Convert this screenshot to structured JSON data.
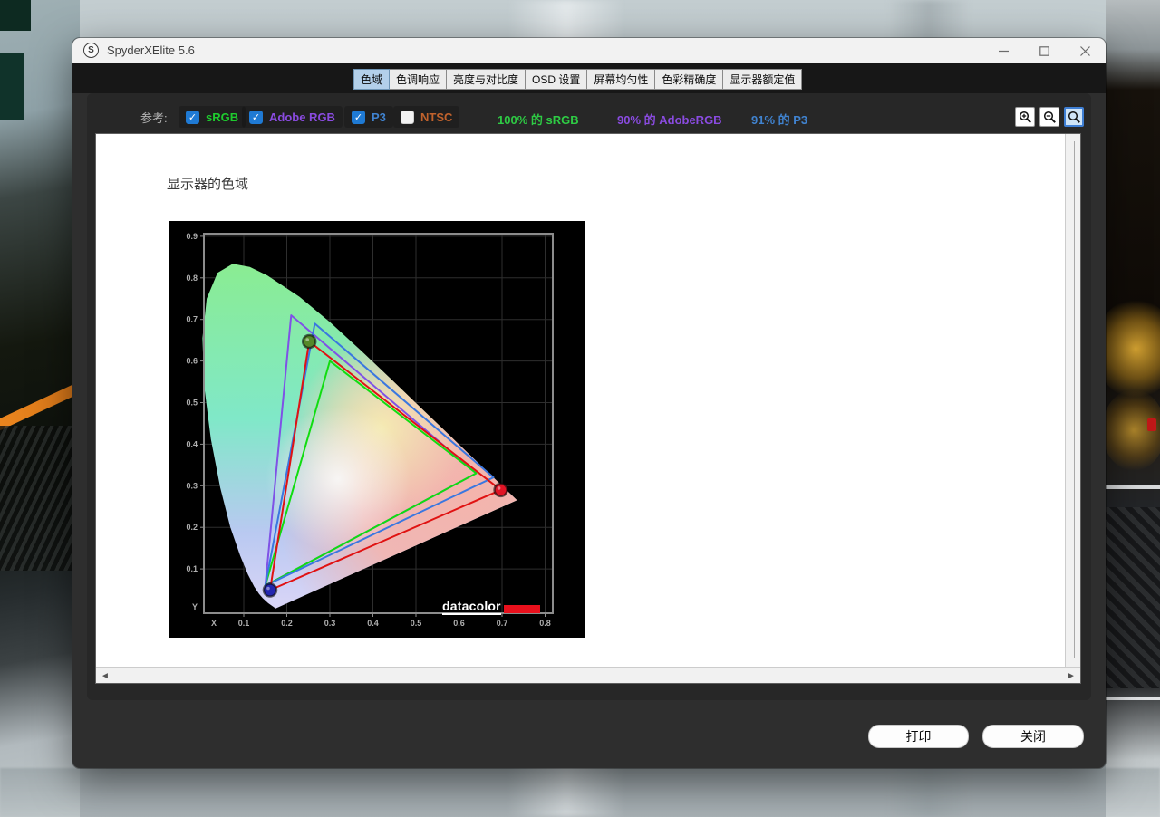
{
  "window": {
    "title": "SpyderXElite 5.6",
    "logo_letter": "S",
    "controls": {
      "minimize": "minimize",
      "maximize": "maximize",
      "close": "close"
    }
  },
  "tabs": {
    "items": [
      {
        "label": "色域",
        "selected": true
      },
      {
        "label": "色调响应",
        "selected": false
      },
      {
        "label": "亮度与对比度",
        "selected": false
      },
      {
        "label": "OSD 设置",
        "selected": false
      },
      {
        "label": "屏幕均匀性",
        "selected": false
      },
      {
        "label": "色彩精确度",
        "selected": false
      },
      {
        "label": "显示器额定值",
        "selected": false
      }
    ]
  },
  "toolbar": {
    "reference_label": "参考:",
    "checkboxes": [
      {
        "label": "sRGB",
        "checked": true,
        "color": "#1ecb2e"
      },
      {
        "label": "Adobe RGB",
        "checked": true,
        "color": "#8a4be0"
      },
      {
        "label": "P3",
        "checked": true,
        "color": "#4083d0"
      },
      {
        "label": "NTSC",
        "checked": false,
        "color": "#c0622c"
      }
    ],
    "summaries": [
      {
        "text": "100% 的 sRGB",
        "color": "#2ecb44"
      },
      {
        "text": "90% 的 AdobeRGB",
        "color": "#8a4be0"
      },
      {
        "text": "91% 的 P3",
        "color": "#4083d0"
      }
    ],
    "zoom_buttons": [
      {
        "name": "zoom-in",
        "selected": false
      },
      {
        "name": "zoom-out",
        "selected": false
      },
      {
        "name": "zoom-reset",
        "selected": true
      }
    ]
  },
  "content": {
    "heading": "显示器的色域"
  },
  "chart_data": {
    "type": "scatter",
    "title": "显示器的色域",
    "xlabel": "X",
    "ylabel": "Y",
    "xlim": [
      0,
      0.8
    ],
    "ylim": [
      0,
      0.9
    ],
    "xticks": [
      0.1,
      0.2,
      0.3,
      0.4,
      0.5,
      0.6,
      0.7,
      0.8
    ],
    "yticks": [
      0.1,
      0.2,
      0.3,
      0.4,
      0.5,
      0.6,
      0.7,
      0.8,
      0.9
    ],
    "grid": true,
    "background": "#000000",
    "watermark": "datacolor",
    "spectral_locus": [
      [
        0.1741,
        0.005
      ],
      [
        0.1566,
        0.0177
      ],
      [
        0.144,
        0.0297
      ],
      [
        0.1355,
        0.0399
      ],
      [
        0.1241,
        0.0578
      ],
      [
        0.1096,
        0.0868
      ],
      [
        0.0913,
        0.1327
      ],
      [
        0.0687,
        0.2007
      ],
      [
        0.0454,
        0.295
      ],
      [
        0.0235,
        0.4127
      ],
      [
        0.0082,
        0.5384
      ],
      [
        0.0039,
        0.6548
      ],
      [
        0.0139,
        0.7502
      ],
      [
        0.0389,
        0.812
      ],
      [
        0.0743,
        0.8338
      ],
      [
        0.1142,
        0.8262
      ],
      [
        0.1547,
        0.8059
      ],
      [
        0.2296,
        0.7543
      ],
      [
        0.3016,
        0.6923
      ],
      [
        0.3731,
        0.6245
      ],
      [
        0.4441,
        0.5547
      ],
      [
        0.5125,
        0.4866
      ],
      [
        0.5752,
        0.4242
      ],
      [
        0.627,
        0.3725
      ],
      [
        0.6915,
        0.3083
      ],
      [
        0.7347,
        0.2653
      ]
    ],
    "series": [
      {
        "name": "Adobe RGB",
        "color": "#7f52e6",
        "vertices": [
          [
            0.64,
            0.33
          ],
          [
            0.21,
            0.71
          ],
          [
            0.15,
            0.06
          ]
        ]
      },
      {
        "name": "sRGB",
        "color": "#10dd10",
        "vertices": [
          [
            0.64,
            0.33
          ],
          [
            0.3,
            0.6
          ],
          [
            0.15,
            0.06
          ]
        ]
      },
      {
        "name": "P3",
        "color": "#3a77e0",
        "vertices": [
          [
            0.68,
            0.32
          ],
          [
            0.265,
            0.69
          ],
          [
            0.15,
            0.06
          ]
        ]
      },
      {
        "name": "display-gamut",
        "color": "#e01212",
        "vertices": [
          [
            0.697,
            0.29
          ],
          [
            0.252,
            0.647
          ],
          [
            0.161,
            0.049
          ]
        ]
      }
    ],
    "measured_points": [
      {
        "name": "green-primary",
        "x": 0.252,
        "y": 0.647,
        "color": "#55882a"
      },
      {
        "name": "red-primary",
        "x": 0.697,
        "y": 0.29,
        "color": "#e01425"
      },
      {
        "name": "blue-primary",
        "x": 0.161,
        "y": 0.049,
        "color": "#2326b0"
      }
    ],
    "coverage": {
      "sRGB": "100%",
      "AdobeRGB": "90%",
      "P3": "91%"
    }
  },
  "footer": {
    "print_label": "打印",
    "close_label": "关闭"
  },
  "scrollbar": {
    "left_arrow": "◄",
    "right_arrow": "►"
  }
}
